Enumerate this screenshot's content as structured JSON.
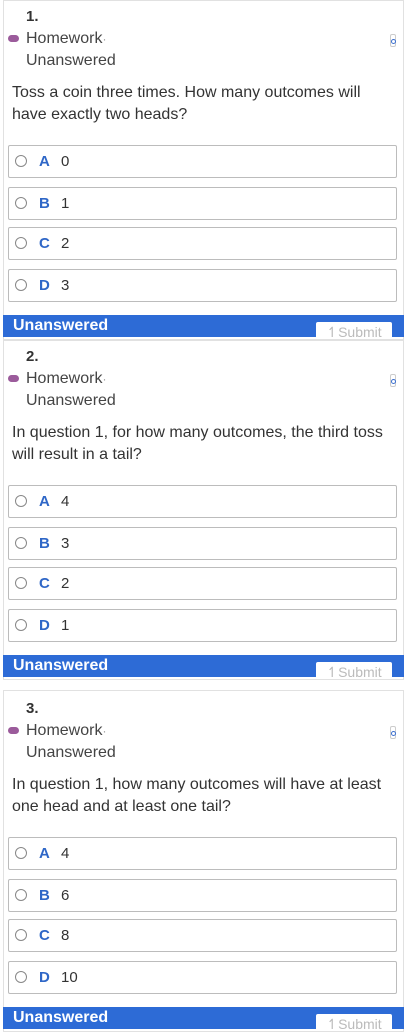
{
  "questions": [
    {
      "number": "1.",
      "category": "Homework",
      "separator": "·",
      "status": "Unanswered",
      "text": "Toss a coin three times. How many outcomes will have exactly two heads?",
      "options": [
        {
          "letter": "A",
          "text": "0"
        },
        {
          "letter": "B",
          "text": "1"
        },
        {
          "letter": "C",
          "text": "2"
        },
        {
          "letter": "D",
          "text": "3"
        }
      ],
      "footer_status": "Unanswered",
      "submit_label": "↿Submit"
    },
    {
      "number": "2.",
      "category": "Homework",
      "separator": "·",
      "status": "Unanswered",
      "text": "In question 1, for how many outcomes, the third toss will result in a tail?",
      "options": [
        {
          "letter": "A",
          "text": "4"
        },
        {
          "letter": "B",
          "text": "3"
        },
        {
          "letter": "C",
          "text": "2"
        },
        {
          "letter": "D",
          "text": "1"
        }
      ],
      "footer_status": "Unanswered",
      "submit_label": "↿Submit"
    },
    {
      "number": "3.",
      "category": "Homework",
      "separator": "·",
      "status": "Unanswered",
      "text": "In question 1, how many outcomes will have at least one head and at least one tail?",
      "options": [
        {
          "letter": "A",
          "text": "4"
        },
        {
          "letter": "B",
          "text": "6"
        },
        {
          "letter": "C",
          "text": "8"
        },
        {
          "letter": "D",
          "text": "10"
        }
      ],
      "footer_status": "Unanswered",
      "submit_label": "↿Submit"
    }
  ]
}
